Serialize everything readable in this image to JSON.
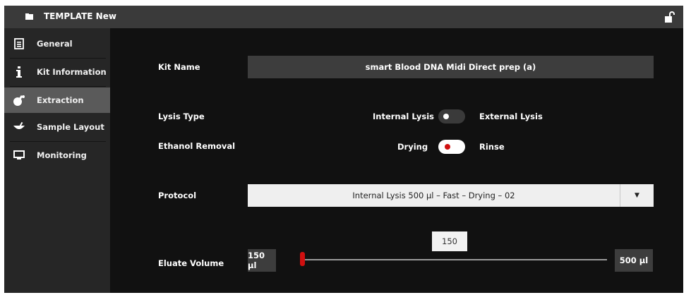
{
  "window": {
    "title": "TEMPLATE New"
  },
  "sidebar": {
    "items": [
      {
        "label": "General",
        "icon": "document-icon"
      },
      {
        "label": "Kit Information",
        "icon": "info-icon"
      },
      {
        "label": "Extraction",
        "icon": "extraction-icon",
        "active": true
      },
      {
        "label": "Sample Layout",
        "icon": "tray-icon"
      },
      {
        "label": "Monitoring",
        "icon": "monitor-icon"
      }
    ]
  },
  "form": {
    "kit_name": {
      "label": "Kit Name",
      "value": "smart Blood DNA Midi Direct prep (a)"
    },
    "lysis_type": {
      "label": "Lysis Type",
      "left_option": "Internal Lysis",
      "right_option": "External Lysis",
      "state": "Internal Lysis"
    },
    "ethanol_removal": {
      "label": "Ethanol Removal",
      "left_option": "Drying",
      "right_option": "Rinse",
      "state": "Drying"
    },
    "protocol": {
      "label": "Protocol",
      "value": "Internal Lysis 500 µl – Fast – Drying – 02"
    },
    "eluate_volume": {
      "label": "Eluate Volume",
      "value": "150",
      "min_label": "150 µl",
      "max_label": "500 µl",
      "min": 150,
      "max": 500,
      "current": 150
    }
  },
  "colors": {
    "accent": "#d01010",
    "background": "#111111",
    "sidebar": "#262626",
    "active_item": "#5a5a5a"
  }
}
